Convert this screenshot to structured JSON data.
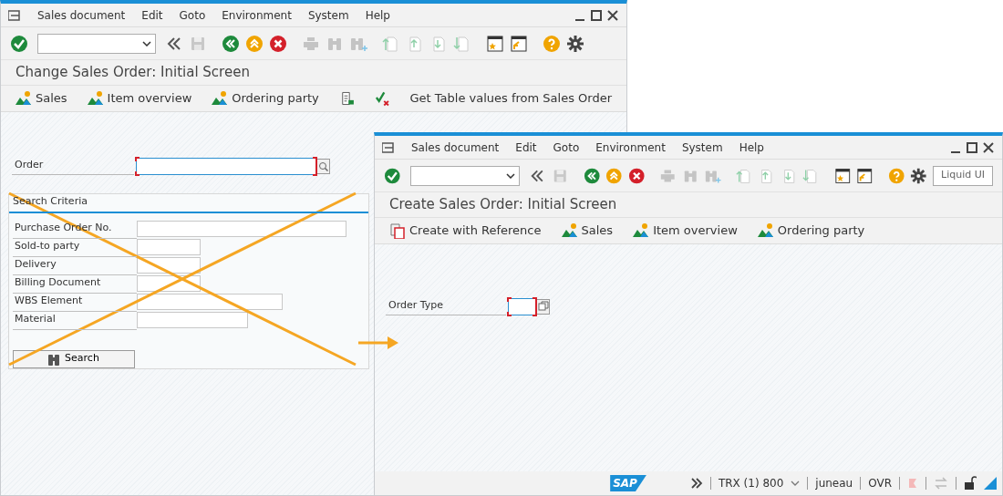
{
  "windows": [
    {
      "menu": [
        "Sales document",
        "Edit",
        "Goto",
        "Environment",
        "System",
        "Help"
      ],
      "title": "Change Sales Order: Initial Screen",
      "app_toolbar": [
        {
          "kind": "mountain",
          "label": "Sales"
        },
        {
          "kind": "mountain",
          "label": "Item overview"
        },
        {
          "kind": "mountain",
          "label": "Ordering party"
        },
        {
          "kind": "clipboard"
        },
        {
          "kind": "check-cross"
        },
        {
          "kind": "text",
          "label": "Get Table values from Sales Order"
        }
      ],
      "fields": [
        {
          "label": "Order",
          "required": true,
          "value_help": true
        }
      ],
      "search_criteria": {
        "title": "Search Criteria",
        "fields": [
          "Purchase Order No.",
          "Sold-to party",
          "Delivery",
          "Billing Document",
          "WBS Element",
          "Material"
        ],
        "button": "Search"
      }
    },
    {
      "menu": [
        "Sales document",
        "Edit",
        "Goto",
        "Environment",
        "System",
        "Help"
      ],
      "toolbar_button": "Liquid UI",
      "title": "Create Sales Order: Initial Screen",
      "app_toolbar": [
        {
          "kind": "reference",
          "label": "Create with Reference"
        },
        {
          "kind": "mountain",
          "label": "Sales"
        },
        {
          "kind": "mountain",
          "label": "Item overview"
        },
        {
          "kind": "mountain",
          "label": "Ordering party"
        }
      ],
      "fields": [
        {
          "label": "Order Type",
          "required": true,
          "value_help": true
        }
      ],
      "status_bar": {
        "logo": "SAP",
        "system": "TRX (1) 800",
        "user": "juneau",
        "mode": "OVR"
      }
    }
  ]
}
